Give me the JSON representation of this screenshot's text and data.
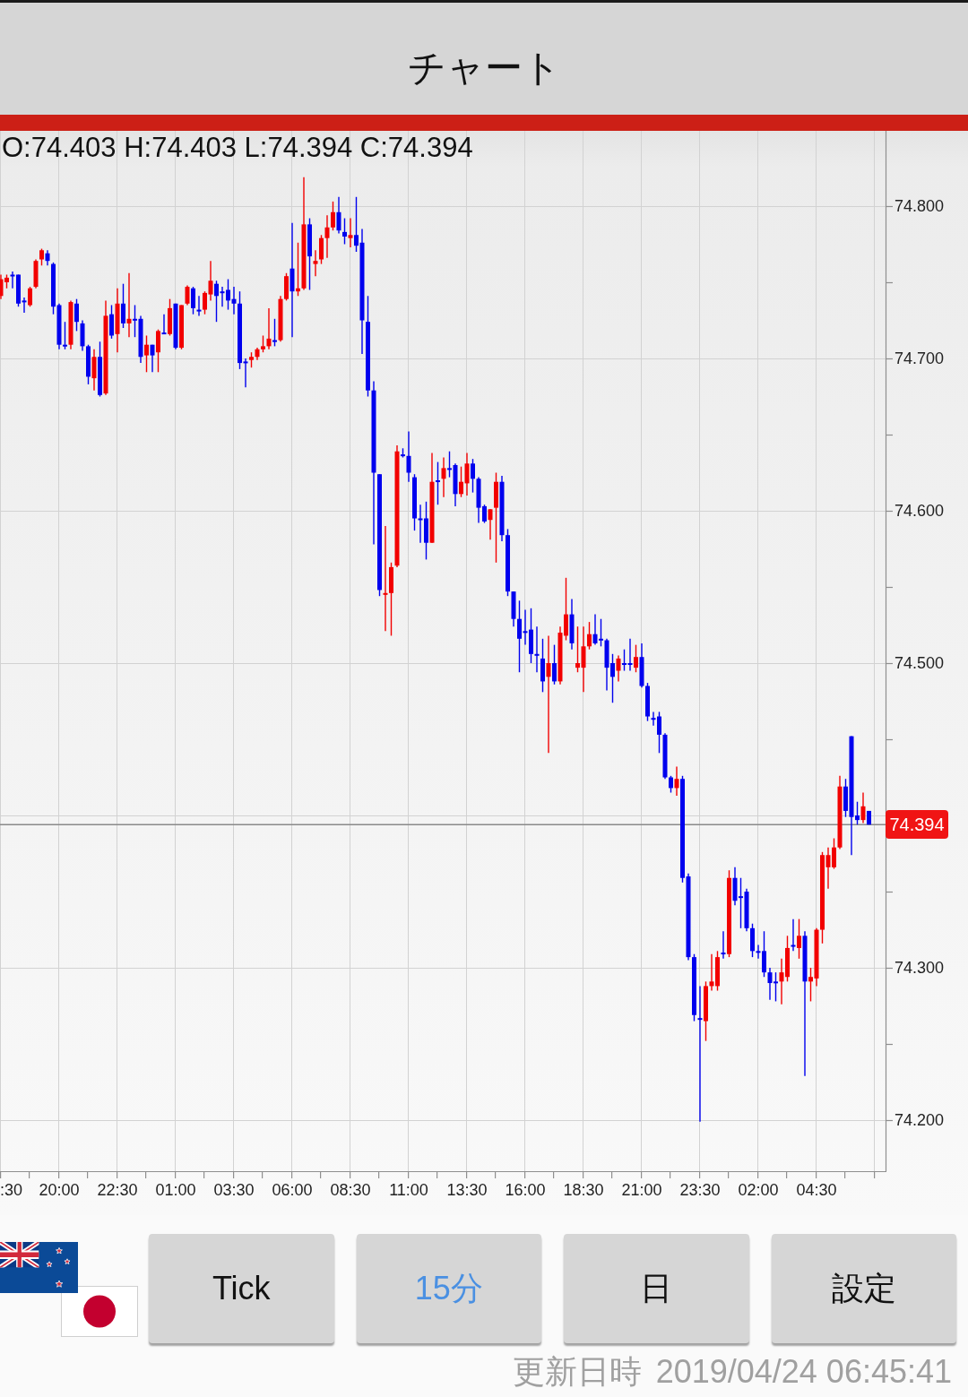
{
  "header": {
    "title": "チャート"
  },
  "chart": {
    "ohlc_readout": "O:74.403 H:74.403 L:74.394 C:74.394",
    "chart_data": {
      "type": "candlestick",
      "grid": true,
      "x": [
        "2019-04-22T17:30",
        "2019-04-22T17:45",
        "2019-04-22T18:00",
        "2019-04-22T18:15",
        "2019-04-22T18:30",
        "2019-04-22T18:45",
        "2019-04-22T19:00",
        "2019-04-22T19:15",
        "2019-04-22T19:30",
        "2019-04-22T19:45",
        "2019-04-22T20:00",
        "2019-04-22T20:15",
        "2019-04-22T20:30",
        "2019-04-22T20:45",
        "2019-04-22T21:00",
        "2019-04-22T21:15",
        "2019-04-22T21:30",
        "2019-04-22T21:45",
        "2019-04-22T22:00",
        "2019-04-22T22:15",
        "2019-04-22T22:30",
        "2019-04-22T22:45",
        "2019-04-22T23:00",
        "2019-04-22T23:15",
        "2019-04-22T23:30",
        "2019-04-22T23:45",
        "2019-04-23T00:00",
        "2019-04-23T00:15",
        "2019-04-23T00:30",
        "2019-04-23T00:45",
        "2019-04-23T01:00",
        "2019-04-23T01:15",
        "2019-04-23T01:30",
        "2019-04-23T01:45",
        "2019-04-23T02:00",
        "2019-04-23T02:15",
        "2019-04-23T02:30",
        "2019-04-23T02:45",
        "2019-04-23T03:00",
        "2019-04-23T03:15",
        "2019-04-23T03:30",
        "2019-04-23T03:45",
        "2019-04-23T04:00",
        "2019-04-23T04:15",
        "2019-04-23T04:30",
        "2019-04-23T04:45",
        "2019-04-23T05:00",
        "2019-04-23T05:15",
        "2019-04-23T05:30",
        "2019-04-23T05:45",
        "2019-04-23T06:00",
        "2019-04-23T06:15",
        "2019-04-23T06:30",
        "2019-04-23T06:45",
        "2019-04-23T07:00",
        "2019-04-23T07:15",
        "2019-04-23T07:30",
        "2019-04-23T07:45",
        "2019-04-23T08:00",
        "2019-04-23T08:15",
        "2019-04-23T08:30",
        "2019-04-23T08:45",
        "2019-04-23T09:00",
        "2019-04-23T09:15",
        "2019-04-23T09:30",
        "2019-04-23T09:45",
        "2019-04-23T10:00",
        "2019-04-23T10:15",
        "2019-04-23T10:30",
        "2019-04-23T10:45",
        "2019-04-23T11:00",
        "2019-04-23T11:15",
        "2019-04-23T11:30",
        "2019-04-23T11:45",
        "2019-04-23T12:00",
        "2019-04-23T12:15",
        "2019-04-23T12:30",
        "2019-04-23T12:45",
        "2019-04-23T13:00",
        "2019-04-23T13:15",
        "2019-04-23T13:30",
        "2019-04-23T13:45",
        "2019-04-23T14:00",
        "2019-04-23T14:15",
        "2019-04-23T14:30",
        "2019-04-23T14:45",
        "2019-04-23T15:00",
        "2019-04-23T15:15",
        "2019-04-23T15:30",
        "2019-04-23T15:45",
        "2019-04-23T16:00",
        "2019-04-23T16:15",
        "2019-04-23T16:30",
        "2019-04-23T16:45",
        "2019-04-23T17:00",
        "2019-04-23T17:15",
        "2019-04-23T17:30",
        "2019-04-23T17:45",
        "2019-04-23T18:00",
        "2019-04-23T18:15",
        "2019-04-23T18:30",
        "2019-04-23T18:45",
        "2019-04-23T19:00",
        "2019-04-23T19:15",
        "2019-04-23T19:30",
        "2019-04-23T19:45",
        "2019-04-23T20:00",
        "2019-04-23T20:15",
        "2019-04-23T20:30",
        "2019-04-23T20:45",
        "2019-04-23T21:00",
        "2019-04-23T21:15",
        "2019-04-23T21:30",
        "2019-04-23T21:45",
        "2019-04-23T22:00",
        "2019-04-23T22:15",
        "2019-04-23T22:30",
        "2019-04-23T22:45",
        "2019-04-23T23:00",
        "2019-04-23T23:15",
        "2019-04-23T23:30",
        "2019-04-23T23:45",
        "2019-04-24T00:00",
        "2019-04-24T00:15",
        "2019-04-24T00:30",
        "2019-04-24T00:45",
        "2019-04-24T01:00",
        "2019-04-24T01:15",
        "2019-04-24T01:30",
        "2019-04-24T01:45",
        "2019-04-24T02:00",
        "2019-04-24T02:15",
        "2019-04-24T02:30",
        "2019-04-24T02:45",
        "2019-04-24T03:00",
        "2019-04-24T03:15",
        "2019-04-24T03:30",
        "2019-04-24T03:45",
        "2019-04-24T04:00",
        "2019-04-24T04:15",
        "2019-04-24T04:30",
        "2019-04-24T04:45",
        "2019-04-24T05:00",
        "2019-04-24T05:15",
        "2019-04-24T05:30",
        "2019-04-24T05:45",
        "2019-04-24T06:00",
        "2019-04-24T06:15",
        "2019-04-24T06:30",
        "2019-04-24T06:45"
      ],
      "ohlc": [
        [
          74.741,
          74.755,
          74.739,
          74.752
        ],
        [
          74.75,
          74.755,
          74.746,
          74.753
        ],
        [
          74.755,
          74.757,
          74.746,
          74.754
        ],
        [
          74.755,
          74.755,
          74.734,
          74.736
        ],
        [
          74.738,
          74.74,
          74.73,
          74.737
        ],
        [
          74.735,
          74.747,
          74.734,
          74.746
        ],
        [
          74.747,
          74.765,
          74.746,
          74.764
        ],
        [
          74.765,
          74.772,
          74.761,
          74.771
        ],
        [
          74.769,
          74.771,
          74.761,
          74.764
        ],
        [
          74.762,
          74.763,
          74.729,
          74.734
        ],
        [
          74.735,
          74.736,
          74.706,
          74.709
        ],
        [
          74.709,
          74.724,
          74.706,
          74.708
        ],
        [
          74.709,
          74.738,
          74.706,
          74.737
        ],
        [
          74.736,
          74.739,
          74.718,
          74.724
        ],
        [
          74.723,
          74.725,
          74.705,
          74.708
        ],
        [
          74.708,
          74.709,
          74.683,
          74.688
        ],
        [
          74.687,
          74.706,
          74.679,
          74.701
        ],
        [
          74.701,
          74.711,
          74.675,
          74.676
        ],
        [
          74.677,
          74.738,
          74.676,
          74.728
        ],
        [
          74.729,
          74.735,
          74.713,
          74.715
        ],
        [
          74.716,
          74.746,
          74.704,
          74.736
        ],
        [
          74.736,
          74.749,
          74.72,
          74.723
        ],
        [
          74.723,
          74.756,
          74.714,
          74.726
        ],
        [
          74.726,
          74.735,
          74.714,
          74.725
        ],
        [
          74.726,
          74.728,
          74.697,
          74.701
        ],
        [
          74.702,
          74.715,
          74.691,
          74.709
        ],
        [
          74.709,
          74.709,
          74.691,
          74.702
        ],
        [
          74.704,
          74.719,
          74.691,
          74.718
        ],
        [
          74.717,
          74.729,
          74.716,
          74.716
        ],
        [
          74.716,
          74.739,
          74.715,
          74.733
        ],
        [
          74.736,
          74.736,
          74.706,
          74.707
        ],
        [
          74.707,
          74.735,
          74.706,
          74.735
        ],
        [
          74.736,
          74.748,
          74.735,
          74.747
        ],
        [
          74.746,
          74.747,
          74.729,
          74.733
        ],
        [
          74.732,
          74.741,
          74.728,
          74.731
        ],
        [
          74.732,
          74.744,
          74.729,
          74.743
        ],
        [
          74.742,
          74.764,
          74.738,
          74.751
        ],
        [
          74.749,
          74.751,
          74.724,
          74.741
        ],
        [
          74.744,
          74.747,
          74.734,
          74.743
        ],
        [
          74.745,
          74.752,
          74.732,
          74.738
        ],
        [
          74.739,
          74.747,
          74.729,
          74.736
        ],
        [
          74.736,
          74.744,
          74.693,
          74.697
        ],
        [
          74.698,
          74.7,
          74.681,
          74.697
        ],
        [
          74.699,
          74.704,
          74.694,
          74.701
        ],
        [
          74.701,
          74.707,
          74.699,
          74.706
        ],
        [
          74.706,
          74.715,
          74.704,
          74.708
        ],
        [
          74.708,
          74.733,
          74.706,
          74.713
        ],
        [
          74.712,
          74.726,
          74.708,
          74.711
        ],
        [
          74.712,
          74.741,
          74.711,
          74.739
        ],
        [
          74.739,
          74.756,
          74.738,
          74.754
        ],
        [
          74.759,
          74.789,
          74.714,
          74.744
        ],
        [
          74.744,
          74.776,
          74.741,
          74.746
        ],
        [
          74.746,
          74.819,
          74.745,
          74.788
        ],
        [
          74.788,
          74.792,
          74.745,
          74.767
        ],
        [
          74.762,
          74.771,
          74.754,
          74.764
        ],
        [
          74.765,
          74.781,
          74.762,
          74.779
        ],
        [
          74.779,
          74.794,
          74.766,
          74.786
        ],
        [
          74.786,
          74.803,
          74.784,
          74.796
        ],
        [
          74.796,
          74.806,
          74.782,
          74.784
        ],
        [
          74.783,
          74.792,
          74.775,
          74.78
        ],
        [
          74.779,
          74.792,
          74.773,
          74.781
        ],
        [
          74.781,
          74.806,
          74.77,
          74.774
        ],
        [
          74.776,
          74.785,
          74.703,
          74.725
        ],
        [
          74.724,
          74.741,
          74.675,
          74.679
        ],
        [
          74.679,
          74.685,
          74.578,
          74.625
        ],
        [
          74.624,
          74.624,
          74.544,
          74.548
        ],
        [
          74.545,
          74.59,
          74.521,
          74.546
        ],
        [
          74.546,
          74.566,
          74.518,
          74.563
        ],
        [
          74.564,
          74.643,
          74.563,
          74.639
        ],
        [
          74.637,
          74.641,
          74.635,
          74.636
        ],
        [
          74.636,
          74.652,
          74.619,
          74.625
        ],
        [
          74.622,
          74.624,
          74.587,
          74.595
        ],
        [
          74.595,
          74.604,
          74.579,
          74.594
        ],
        [
          74.595,
          74.606,
          74.568,
          74.579
        ],
        [
          74.579,
          74.638,
          74.579,
          74.619
        ],
        [
          74.62,
          74.632,
          74.604,
          74.619
        ],
        [
          74.621,
          74.635,
          74.609,
          74.628
        ],
        [
          74.628,
          74.639,
          74.622,
          74.627
        ],
        [
          74.63,
          74.631,
          74.603,
          74.611
        ],
        [
          74.611,
          74.629,
          74.609,
          74.619
        ],
        [
          74.618,
          74.638,
          74.61,
          74.631
        ],
        [
          74.631,
          74.634,
          74.612,
          74.621
        ],
        [
          74.621,
          74.622,
          74.592,
          74.602
        ],
        [
          74.603,
          74.604,
          74.592,
          74.593
        ],
        [
          74.594,
          74.601,
          74.581,
          74.601
        ],
        [
          74.602,
          74.625,
          74.566,
          74.619
        ],
        [
          74.619,
          74.623,
          74.58,
          74.584
        ],
        [
          74.584,
          74.588,
          74.544,
          74.547
        ],
        [
          74.547,
          74.547,
          74.524,
          74.529
        ],
        [
          74.529,
          74.541,
          74.494,
          74.516
        ],
        [
          74.521,
          74.535,
          74.512,
          74.52
        ],
        [
          74.522,
          74.536,
          74.5,
          74.506
        ],
        [
          74.506,
          74.524,
          74.494,
          74.505
        ],
        [
          74.503,
          74.516,
          74.481,
          74.488
        ],
        [
          74.491,
          74.518,
          74.441,
          74.5
        ],
        [
          74.5,
          74.512,
          74.486,
          74.488
        ],
        [
          74.488,
          74.524,
          74.486,
          74.52
        ],
        [
          74.518,
          74.556,
          74.515,
          74.532
        ],
        [
          74.532,
          74.542,
          74.509,
          74.513
        ],
        [
          74.497,
          74.524,
          74.494,
          74.5
        ],
        [
          74.497,
          74.524,
          74.481,
          74.511
        ],
        [
          74.511,
          74.527,
          74.509,
          74.519
        ],
        [
          74.519,
          74.532,
          74.512,
          74.513
        ],
        [
          74.516,
          74.529,
          74.511,
          74.515
        ],
        [
          74.515,
          74.516,
          74.482,
          74.497
        ],
        [
          74.5,
          74.506,
          74.474,
          74.491
        ],
        [
          74.495,
          74.505,
          74.488,
          74.503
        ],
        [
          74.5,
          74.509,
          74.495,
          74.499
        ],
        [
          74.5,
          74.516,
          74.495,
          74.499
        ],
        [
          74.497,
          74.512,
          74.494,
          74.504
        ],
        [
          74.504,
          74.513,
          74.484,
          74.485
        ],
        [
          74.485,
          74.487,
          74.462,
          74.465
        ],
        [
          74.464,
          74.468,
          74.459,
          74.463
        ],
        [
          74.465,
          74.468,
          74.441,
          74.453
        ],
        [
          74.453,
          74.454,
          74.424,
          74.425
        ],
        [
          74.425,
          74.426,
          74.415,
          74.418
        ],
        [
          74.418,
          74.432,
          74.413,
          74.424
        ],
        [
          74.424,
          74.426,
          74.356,
          74.359
        ],
        [
          74.36,
          74.362,
          74.305,
          74.307
        ],
        [
          74.307,
          74.309,
          74.265,
          74.269
        ],
        [
          74.267,
          74.288,
          74.199,
          74.266
        ],
        [
          74.265,
          74.291,
          74.252,
          74.288
        ],
        [
          74.288,
          74.309,
          74.285,
          74.291
        ],
        [
          74.288,
          74.311,
          74.285,
          74.307
        ],
        [
          74.31,
          74.324,
          74.306,
          74.309
        ],
        [
          74.309,
          74.364,
          74.307,
          74.359
        ],
        [
          74.359,
          74.366,
          74.341,
          74.344
        ],
        [
          74.347,
          74.359,
          74.326,
          74.346
        ],
        [
          74.35,
          74.352,
          74.324,
          74.326
        ],
        [
          74.326,
          74.329,
          74.307,
          74.311
        ],
        [
          74.311,
          74.315,
          74.306,
          74.31
        ],
        [
          74.311,
          74.324,
          74.294,
          74.297
        ],
        [
          74.297,
          74.3,
          74.279,
          74.29
        ],
        [
          74.291,
          74.297,
          74.278,
          74.29
        ],
        [
          74.291,
          74.306,
          74.276,
          74.297
        ],
        [
          74.294,
          74.321,
          74.291,
          74.313
        ],
        [
          74.315,
          74.332,
          74.311,
          74.314
        ],
        [
          74.313,
          74.332,
          74.306,
          74.321
        ],
        [
          74.321,
          74.324,
          74.229,
          74.291
        ],
        [
          74.291,
          74.3,
          74.278,
          74.294
        ],
        [
          74.293,
          74.326,
          74.288,
          74.325
        ],
        [
          74.325,
          74.376,
          74.316,
          74.374
        ],
        [
          74.366,
          74.379,
          74.352,
          74.374
        ],
        [
          74.366,
          74.385,
          74.365,
          74.379
        ],
        [
          74.379,
          74.426,
          74.378,
          74.419
        ],
        [
          74.419,
          74.424,
          74.399,
          74.403
        ],
        [
          74.452,
          74.452,
          74.374,
          74.399
        ],
        [
          74.4,
          74.409,
          74.394,
          74.397
        ],
        [
          74.397,
          74.415,
          74.395,
          74.406
        ],
        [
          74.403,
          74.403,
          74.394,
          74.394
        ]
      ],
      "xlim": [
        "2019-04-22T17:27:42",
        "2019-04-24T07:27:42"
      ],
      "ylim": [
        74.1665,
        74.8494
      ],
      "xticks": [
        {
          "value": "2019-04-22T17:30",
          "label": ":30"
        },
        {
          "value": "2019-04-22T20:00",
          "label": "20:00"
        },
        {
          "value": "2019-04-22T22:30",
          "label": "22:30"
        },
        {
          "value": "2019-04-23T01:00",
          "label": "01:00"
        },
        {
          "value": "2019-04-23T03:30",
          "label": "03:30"
        },
        {
          "value": "2019-04-23T06:00",
          "label": "06:00"
        },
        {
          "value": "2019-04-23T08:30",
          "label": "08:30"
        },
        {
          "value": "2019-04-23T11:00",
          "label": "11:00"
        },
        {
          "value": "2019-04-23T13:30",
          "label": "13:30"
        },
        {
          "value": "2019-04-23T16:00",
          "label": "16:00"
        },
        {
          "value": "2019-04-23T18:30",
          "label": "18:30"
        },
        {
          "value": "2019-04-23T21:00",
          "label": "21:00"
        },
        {
          "value": "2019-04-23T23:30",
          "label": "23:30"
        },
        {
          "value": "2019-04-24T02:00",
          "label": "02:00"
        },
        {
          "value": "2019-04-24T04:30",
          "label": "04:30"
        }
      ],
      "yticks": [
        {
          "value": 74.8,
          "label": "74.800"
        },
        {
          "value": 74.7,
          "label": "74.700"
        },
        {
          "value": 74.6,
          "label": "74.600"
        },
        {
          "value": 74.5,
          "label": "74.500"
        },
        {
          "value": 74.3,
          "label": "74.300"
        },
        {
          "value": 74.2,
          "label": "74.200"
        }
      ],
      "ref_lines": [
        {
          "axis": "y",
          "value": 74.394,
          "label": "74.394"
        }
      ]
    }
  },
  "timeframes": [
    {
      "label": "Tick",
      "selected": false
    },
    {
      "label": "15分",
      "selected": true
    },
    {
      "label": "日",
      "selected": false
    }
  ],
  "settings_button": {
    "label": "設定"
  },
  "updated": {
    "label": "更新日時",
    "value": "2019/04/24 06:45:41"
  }
}
